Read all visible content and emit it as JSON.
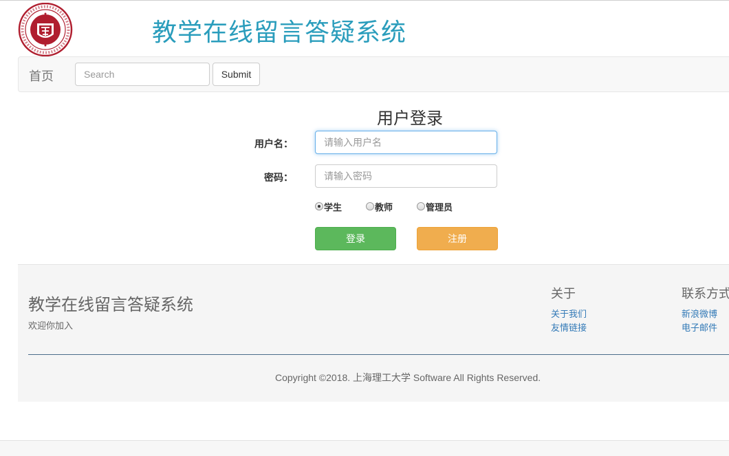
{
  "header": {
    "logo": "university-seal-logo",
    "site_title": "教学在线留言答疑系统"
  },
  "navbar": {
    "home_label": "首页",
    "search_placeholder": "Search",
    "submit_label": "Submit"
  },
  "login": {
    "title": "用户登录",
    "username_label": "用户名：",
    "username_placeholder": "请输入用户名",
    "password_label": "密码：",
    "password_placeholder": "请输入密码",
    "roles": [
      {
        "label": "学生",
        "checked": true
      },
      {
        "label": "教师",
        "checked": false
      },
      {
        "label": "管理员",
        "checked": false
      }
    ],
    "login_button": "登录",
    "register_button": "注册"
  },
  "footer": {
    "title": "教学在线留言答疑系统",
    "welcome": "欢迎你加入",
    "about": {
      "heading": "关于",
      "links": [
        "关于我们",
        "友情链接"
      ]
    },
    "contact": {
      "heading": "联系方式",
      "links": [
        "新浪微博",
        "电子邮件"
      ]
    },
    "copyright": "Copyright ©2018. 上海理工大学 Software All Rights Reserved."
  },
  "colors": {
    "title": "#2a9dbc",
    "login_green": "#5cb85c",
    "register_orange": "#f0ad4e",
    "link_blue": "#337ab7",
    "seal_red": "#b01e2f"
  }
}
